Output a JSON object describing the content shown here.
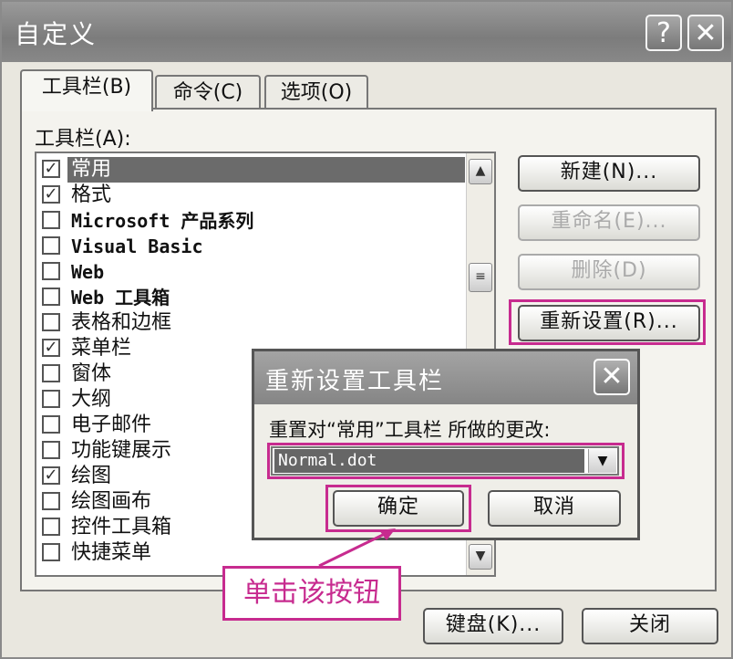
{
  "window": {
    "title": "自定义",
    "help_label": "?",
    "close_label": "✕"
  },
  "tabs": [
    {
      "label": "工具栏(B)"
    },
    {
      "label": "命令(C)"
    },
    {
      "label": "选项(O)"
    }
  ],
  "toolbars_label": "工具栏(A):",
  "toolbar_items": [
    {
      "label": "常用",
      "checked": true,
      "selected": true
    },
    {
      "label": "格式",
      "checked": true
    },
    {
      "label": "Microsoft 产品系列",
      "checked": false
    },
    {
      "label": "Visual Basic",
      "checked": false
    },
    {
      "label": "Web",
      "checked": false
    },
    {
      "label": "Web 工具箱",
      "checked": false
    },
    {
      "label": "表格和边框",
      "checked": false
    },
    {
      "label": "菜单栏",
      "checked": true
    },
    {
      "label": "窗体",
      "checked": false
    },
    {
      "label": "大纲",
      "checked": false
    },
    {
      "label": "电子邮件",
      "checked": false
    },
    {
      "label": "功能键展示",
      "checked": false
    },
    {
      "label": "绘图",
      "checked": true
    },
    {
      "label": "绘图画布",
      "checked": false
    },
    {
      "label": "控件工具箱",
      "checked": false
    },
    {
      "label": "快捷菜单",
      "checked": false
    }
  ],
  "buttons": {
    "new": "新建(N)...",
    "rename": "重命名(E)...",
    "delete": "删除(D)",
    "reset": "重新设置(R)...",
    "keyboard": "键盘(K)...",
    "close": "关闭"
  },
  "reset_dialog": {
    "title": "重新设置工具栏",
    "close_label": "✕",
    "prompt": "重置对“常用”工具栏 所做的更改:",
    "template_value": "Normal.dot",
    "ok": "确定",
    "cancel": "取消"
  },
  "annotation": {
    "text": "单击该按钮"
  },
  "colors": {
    "highlight": "#c72b8f",
    "titlebar": "#858585"
  }
}
